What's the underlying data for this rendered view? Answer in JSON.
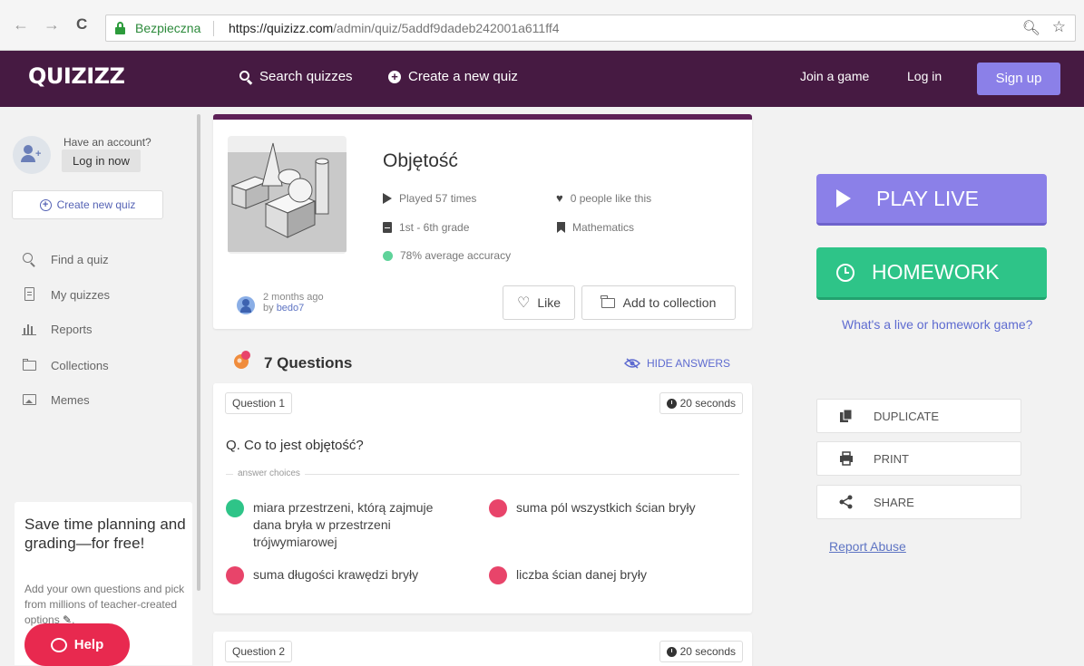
{
  "browser": {
    "back": "←",
    "forward": "→",
    "reload": "C",
    "secure_label": "Bezpieczna",
    "url_domain": "https://quizizz.com",
    "url_path": "/admin/quiz/5addf9dadeb242001a611ff4"
  },
  "header": {
    "logo": "QUIZIZZ",
    "search": "Search quizzes",
    "create": "Create a new quiz",
    "join": "Join a game",
    "login": "Log in",
    "signup": "Sign up"
  },
  "sidebar": {
    "have_account": "Have an account?",
    "login_now": "Log in now",
    "create_quiz": "Create new quiz",
    "items": [
      {
        "label": "Find a quiz",
        "icon": "search-icon"
      },
      {
        "label": "My quizzes",
        "icon": "document-icon"
      },
      {
        "label": "Reports",
        "icon": "bar-chart-icon"
      },
      {
        "label": "Collections",
        "icon": "folder-icon"
      },
      {
        "label": "Memes",
        "icon": "image-icon"
      }
    ],
    "promo_title": "Save time planning and grading—for free!",
    "promo_text": "Add your own questions and pick from millions of teacher-created options",
    "help": "Help"
  },
  "quiz": {
    "title": "Objętość",
    "played": "Played 57 times",
    "likes": "0 people like this",
    "grade": "1st - 6th grade",
    "subject": "Mathematics",
    "accuracy": "78% average accuracy",
    "ago": "2 months ago",
    "by": "by",
    "author": "bedo7",
    "like_btn": "Like",
    "collection_btn": "Add to collection"
  },
  "questions": {
    "count": "7 Questions",
    "hide_answers": "HIDE ANSWERS",
    "answer_choices_label": "answer choices",
    "items": [
      {
        "number": "Question 1",
        "time": "20 seconds",
        "text": "Q. Co to jest objętość?",
        "choices": [
          {
            "text": "miara przestrzeni, którą zajmuje dana bryła w przestrzeni trójwymiarowej",
            "correct": true
          },
          {
            "text": "suma pól wszystkich ścian bryły",
            "correct": false
          },
          {
            "text": "suma długości krawędzi bryły",
            "correct": false
          },
          {
            "text": "liczba ścian danej bryły",
            "correct": false
          }
        ]
      },
      {
        "number": "Question 2",
        "time": "20 seconds"
      }
    ]
  },
  "right": {
    "play_live": "PLAY LIVE",
    "homework": "HOMEWORK",
    "whats": "What's a live or homework game?",
    "duplicate": "DUPLICATE",
    "print": "PRINT",
    "share": "SHARE",
    "report": "Report Abuse"
  },
  "colors": {
    "brand_purple": "#461a42",
    "play_live": "#8b80e8",
    "homework": "#2ec488",
    "correct": "#2ec488",
    "incorrect": "#e8446a",
    "help": "#e8294f"
  }
}
